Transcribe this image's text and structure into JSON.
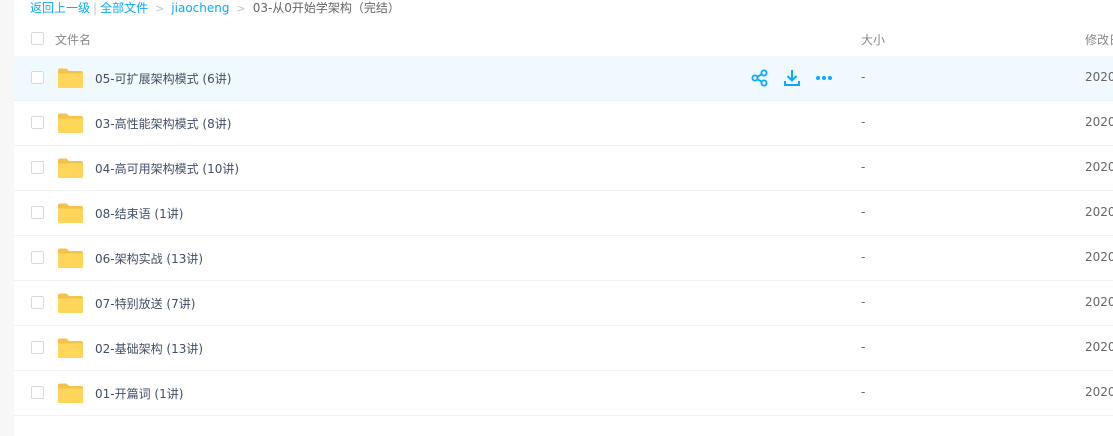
{
  "breadcrumb": {
    "back": "返回上一级",
    "divider": "|",
    "all_files": "全部文件",
    "folder": "jiaocheng",
    "current": "03-从0开始学架构（完结）"
  },
  "header": {
    "name": "文件名",
    "size": "大小",
    "mtime": "修改日"
  },
  "accent_color": "#09aaff",
  "folder_color": "#ffd659",
  "rows": [
    {
      "name": "05-可扩展架构模式 (6讲)",
      "size": "-",
      "mtime": "2020-"
    },
    {
      "name": "03-高性能架构模式 (8讲)",
      "size": "-",
      "mtime": "2020-"
    },
    {
      "name": "04-高可用架构模式 (10讲)",
      "size": "-",
      "mtime": "2020-"
    },
    {
      "name": "08-结束语 (1讲)",
      "size": "-",
      "mtime": "2020-"
    },
    {
      "name": "06-架构实战 (13讲)",
      "size": "-",
      "mtime": "2020-"
    },
    {
      "name": "07-特别放送 (7讲)",
      "size": "-",
      "mtime": "2020-"
    },
    {
      "name": "02-基础架构 (13讲)",
      "size": "-",
      "mtime": "2020-"
    },
    {
      "name": "01-开篇词 (1讲)",
      "size": "-",
      "mtime": "2020-"
    }
  ],
  "row_actions": [
    "share-icon",
    "download-icon",
    "more-icon"
  ]
}
